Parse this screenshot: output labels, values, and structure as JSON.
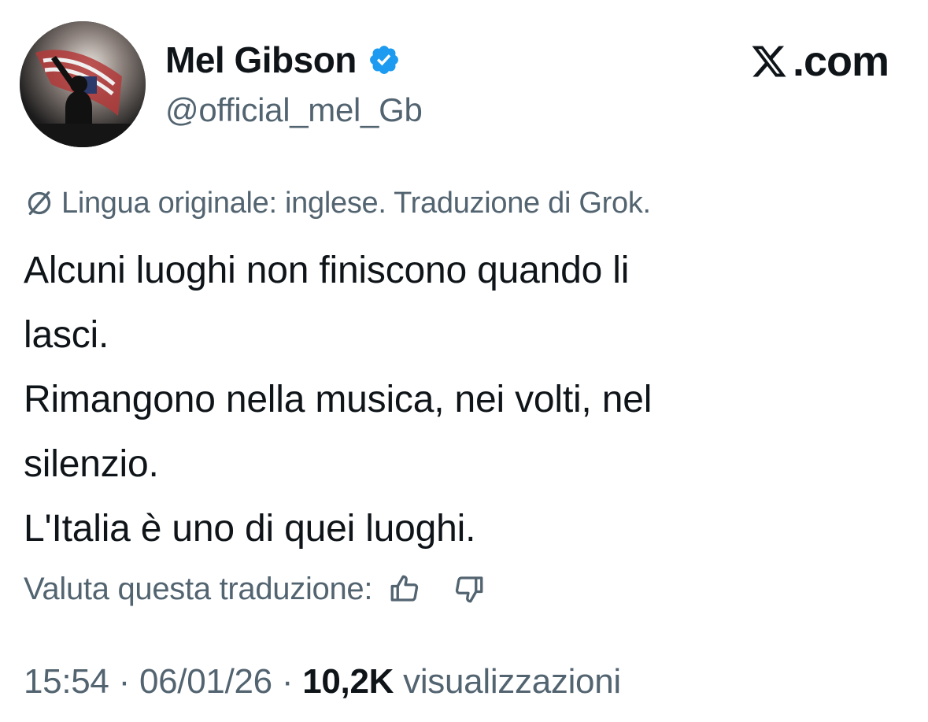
{
  "author": {
    "name": "Mel Gibson",
    "handle": "@official_mel_Gb",
    "verified": true,
    "verified_color": "#1d9bf0"
  },
  "brand": {
    "icon": "x-logo-icon",
    "text": ".com"
  },
  "translation_note": {
    "icon": "translate-icon",
    "text": "Lingua originale: inglese. Traduzione di Grok."
  },
  "tweet": {
    "lines": [
      "Alcuni luoghi non finiscono quando li",
      "lasci.",
      "Rimangono nella musica, nei volti, nel",
      "silenzio.",
      "L'Italia è uno di quei luoghi."
    ]
  },
  "rating": {
    "label": "Valuta questa traduzione:",
    "up_icon": "thumbs-up-icon",
    "down_icon": "thumbs-down-icon"
  },
  "meta": {
    "time": "15:54",
    "separator": "·",
    "date": "06/01/26",
    "views_count": "10,2K",
    "views_label": "visualizzazioni"
  },
  "colors": {
    "text_primary": "#0f1419",
    "text_secondary": "#536471",
    "accent": "#1d9bf0"
  }
}
